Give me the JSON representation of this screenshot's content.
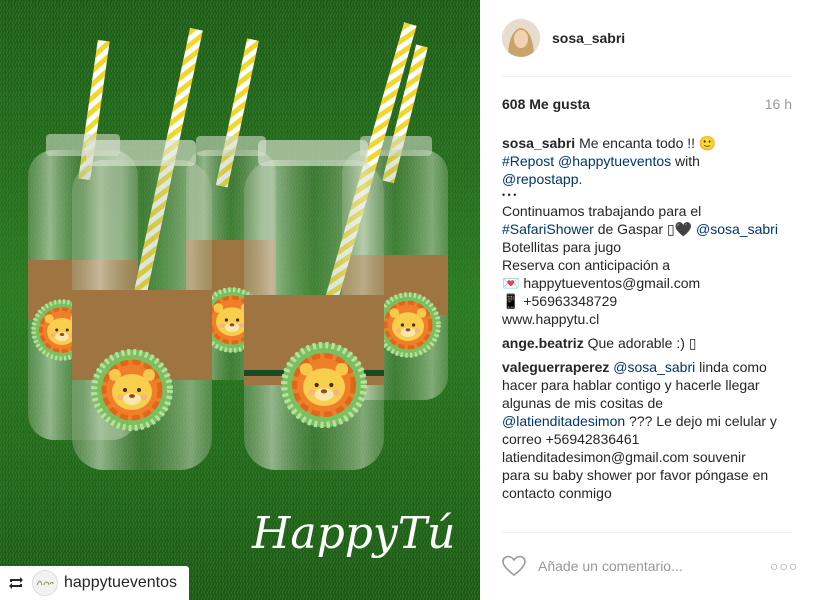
{
  "photo": {
    "watermark": "HappyTú",
    "repost_badge": {
      "account": "happytueventos",
      "avatar_text": "HappyTú"
    }
  },
  "post": {
    "username": "sosa_sabri",
    "likes": "608 Me gusta",
    "time": "16 h",
    "caption": {
      "user": "sosa_sabri",
      "l1": "Me encanta todo !! 🙂",
      "hashtag_repost": "#Repost",
      "mention_happytu": "@happytueventos",
      "with": " with",
      "mention_repostapp": "@repostapp",
      "period": ".",
      "dots": "• • •",
      "l_trabajando": "Continuamos trabajando para el",
      "hashtag_safari": "#SafariShower",
      "de_gaspar": " de Gaspar ▯🖤 ",
      "mention_sosa": "@sosa_sabri",
      "l_botellitas": "Botellitas para jugo",
      "l_reserva": "Reserva con anticipación a",
      "l_email": "💌 happytueventos@gmail.com",
      "l_phone": "📱 +56963348729",
      "l_web": "www.happytu.cl"
    },
    "comments": [
      {
        "user": "ange.beatriz",
        "text": "Que adorable :) ▯"
      },
      {
        "user": "valeguerraperez",
        "mention1": "@sosa_sabri",
        "t1": " linda como",
        "t2": "hacer para hablar contigo y hacerle llegar",
        "t3": "algunas de mis cositas de",
        "mention2": "@latienditadesimon",
        "t4": " ??? Le dejo mi celular y",
        "t5": "correo +56942836461",
        "t6": "latienditadesimon@gmail.com souvenir",
        "t7": "para su baby shower por favor póngase en",
        "t8": "contacto conmigo"
      }
    ],
    "add_comment_placeholder": "Añade un comentario...",
    "more_options": "○○○"
  }
}
